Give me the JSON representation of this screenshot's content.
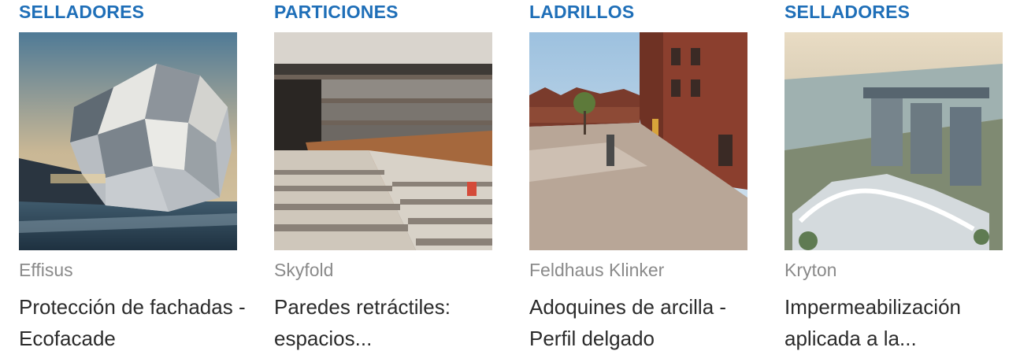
{
  "cards": [
    {
      "category": "SELLADORES",
      "image": "facade-building-photo",
      "brand": "Effisus",
      "title": "Protección de fachadas - Ecofacade"
    },
    {
      "category": "PARTICIONES",
      "image": "auditorium-photo",
      "brand": "Skyfold",
      "title": "Paredes retráctiles: espacios..."
    },
    {
      "category": "LADRILLOS",
      "image": "brick-plaza-photo",
      "brand": "Feldhaus Klinker",
      "title": "Adoquines de arcilla - Perfil delgado"
    },
    {
      "category": "SELLADORES",
      "image": "city-aerial-photo",
      "brand": "Kryton",
      "title": "Impermeabilización aplicada a la..."
    }
  ],
  "colors": {
    "category": "#1f6fb8",
    "brand": "#8a8a8a",
    "title": "#2b2b2b"
  }
}
